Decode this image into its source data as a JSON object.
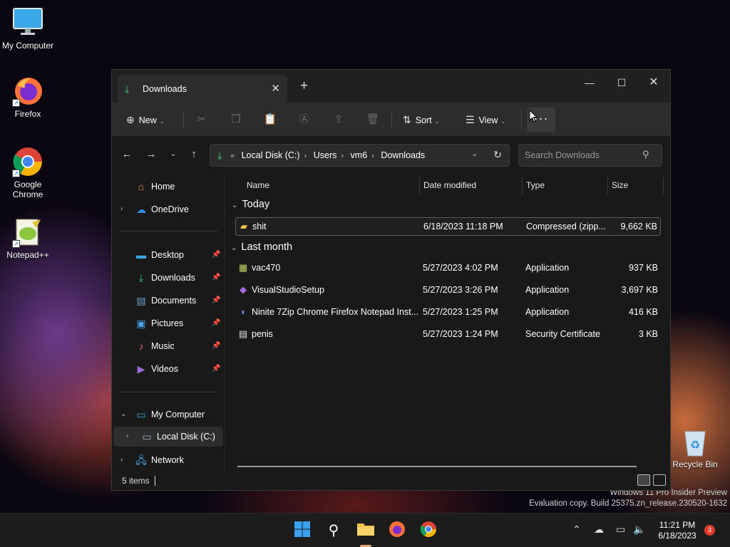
{
  "desktop": {
    "icons": [
      {
        "label": "My Computer",
        "icon": "monitor-icon"
      },
      {
        "label": "Firefox",
        "icon": "firefox-icon"
      },
      {
        "label": "Google Chrome",
        "icon": "chrome-icon"
      },
      {
        "label": "Notepad++",
        "icon": "notepadpp-icon"
      },
      {
        "label": "Recycle Bin",
        "icon": "recycle-bin-icon"
      }
    ],
    "watermark_line1": "Windows 11 Pro Insider Preview",
    "watermark_line2": "Evaluation copy. Build 25375.zn_release.230520-1632"
  },
  "explorer": {
    "tab_title": "Downloads",
    "toolbar": {
      "new_label": "New",
      "sort_label": "Sort",
      "view_label": "View",
      "more_label": "···"
    },
    "address": {
      "overflow": "«",
      "crumbs": [
        "Local Disk (C:)",
        "Users",
        "vm6",
        "Downloads"
      ]
    },
    "search": {
      "placeholder": "Search Downloads"
    },
    "sidebar": {
      "home": "Home",
      "onedrive": "OneDrive",
      "quick": [
        {
          "label": "Desktop"
        },
        {
          "label": "Downloads"
        },
        {
          "label": "Documents"
        },
        {
          "label": "Pictures"
        },
        {
          "label": "Music"
        },
        {
          "label": "Videos"
        }
      ],
      "my_computer": "My Computer",
      "local_disk": "Local Disk (C:)",
      "network": "Network"
    },
    "columns": {
      "name": "Name",
      "date": "Date modified",
      "type": "Type",
      "size": "Size"
    },
    "groups": {
      "today": {
        "label": "Today",
        "files": [
          {
            "name": "shit",
            "date": "6/18/2023 11:18 PM",
            "type": "Compressed (zipp...",
            "size": "9,662 KB"
          }
        ]
      },
      "last_month": {
        "label": "Last month",
        "files": [
          {
            "name": "vac470",
            "date": "5/27/2023 4:02 PM",
            "type": "Application",
            "size": "937 KB"
          },
          {
            "name": "VisualStudioSetup",
            "date": "5/27/2023 3:26 PM",
            "type": "Application",
            "size": "3,697 KB"
          },
          {
            "name": "Ninite 7Zip Chrome Firefox Notepad Inst...",
            "date": "5/27/2023 1:25 PM",
            "type": "Application",
            "size": "416 KB"
          },
          {
            "name": "penis",
            "date": "5/27/2023 1:24 PM",
            "type": "Security Certificate",
            "size": "3 KB"
          }
        ]
      }
    },
    "status": {
      "item_count": "5 items"
    }
  },
  "taskbar": {
    "time": "11:21 PM",
    "date": "6/18/2023",
    "notification_count": "3"
  },
  "colors": {
    "accent_green": "#3ec97a",
    "window_bg": "#191919",
    "toolbar_bg": "#2c2c2c",
    "taskbar_bg": "#1c1c1c",
    "badge_red": "#e03b2f"
  }
}
